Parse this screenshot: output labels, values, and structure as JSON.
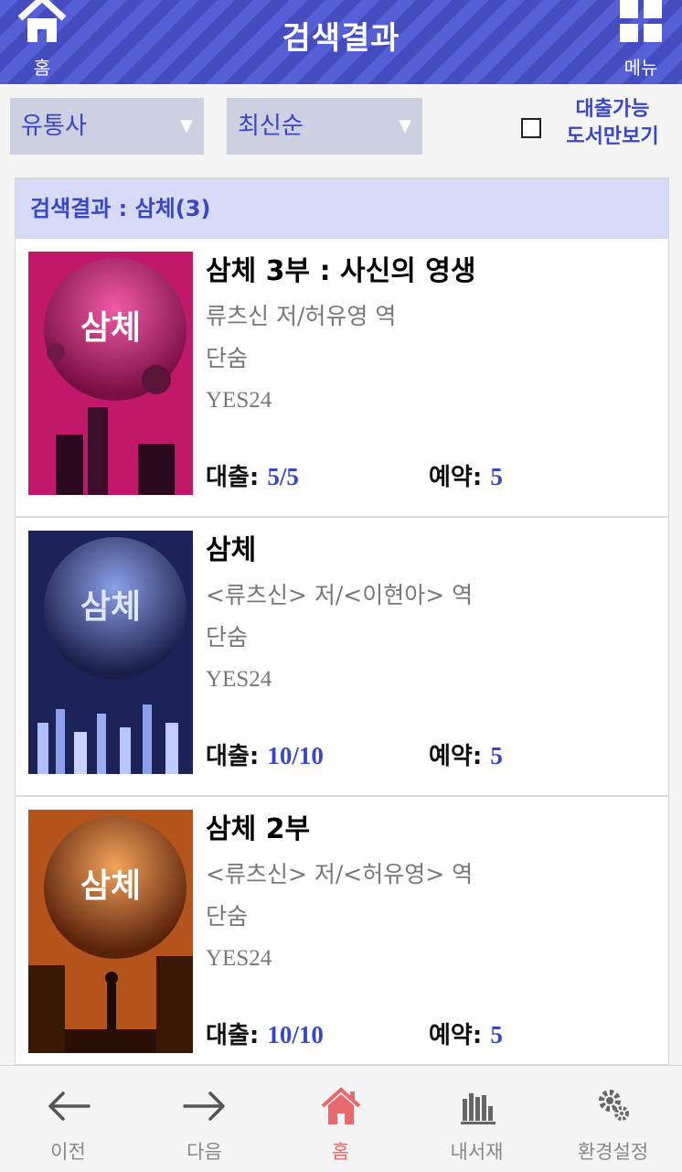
{
  "header": {
    "title": "검색결과",
    "home_label": "홈",
    "menu_label": "메뉴"
  },
  "filters": {
    "distributor": "유통사",
    "sort": "최신순",
    "available_only_line1": "대출가능",
    "available_only_line2": "도서만보기",
    "available_only_checked": false
  },
  "results": {
    "header": "검색결과 : 삼체(3)",
    "stats_labels": {
      "loan": "대출:",
      "reserve": "예약:"
    },
    "items": [
      {
        "title": "삼체 3부 : 사신의 영생",
        "author": "류츠신 저/허유영 역",
        "publisher": "단숨",
        "supplier": "YES24",
        "loan": "5/5",
        "reserve": "5",
        "cover_theme": "magenta",
        "cover_color": "#c2186c"
      },
      {
        "title": "삼체",
        "author": "<류츠신> 저/<이현아> 역",
        "publisher": "단숨",
        "supplier": "YES24",
        "loan": "10/10",
        "reserve": "5",
        "cover_theme": "navy",
        "cover_color": "#1c2358"
      },
      {
        "title": "삼체 2부",
        "author": "<류츠신> 저/<허유영> 역",
        "publisher": "단숨",
        "supplier": "YES24",
        "loan": "10/10",
        "reserve": "5",
        "cover_theme": "orange",
        "cover_color": "#b5541a"
      }
    ]
  },
  "bottom_nav": [
    {
      "label": "이전",
      "icon": "arrow-left-icon"
    },
    {
      "label": "다음",
      "icon": "arrow-right-icon"
    },
    {
      "label": "홈",
      "icon": "home-icon",
      "active": true
    },
    {
      "label": "내서재",
      "icon": "bookshelf-icon"
    },
    {
      "label": "환경설정",
      "icon": "gear-icon"
    }
  ],
  "colors": {
    "accent": "#3a46c8",
    "header": "#4a52c8",
    "result_header_bg": "#d6daf7",
    "active_nav": "#e9686b"
  }
}
